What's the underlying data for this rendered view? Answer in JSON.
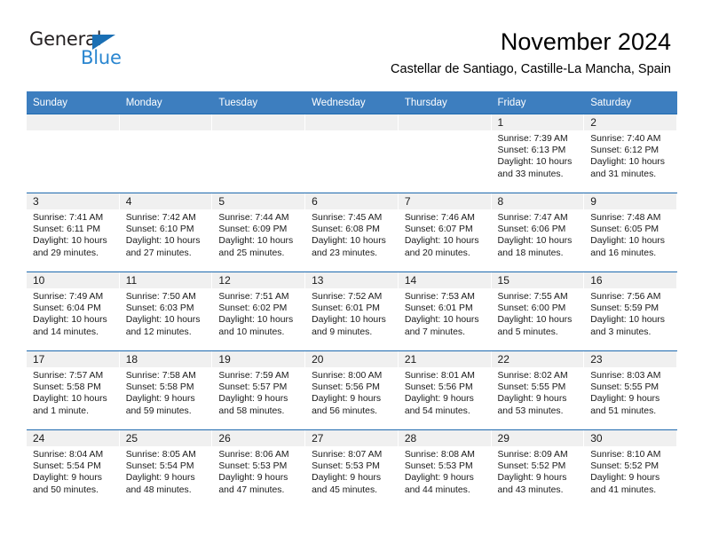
{
  "brand": {
    "name_part1": "General",
    "name_part2": "Blue",
    "accent_color": "#2a86d0",
    "triangle_color": "#1a6fb4"
  },
  "header": {
    "title": "November 2024",
    "subtitle": "Castellar de Santiago, Castille-La Mancha, Spain",
    "header_bg": "#3d7ebf",
    "header_text": "#ffffff",
    "row_rule_color": "#1f6aaf",
    "daynum_band_bg": "#f0f0f0"
  },
  "weekday_headers": [
    "Sunday",
    "Monday",
    "Tuesday",
    "Wednesday",
    "Thursday",
    "Friday",
    "Saturday"
  ],
  "labels": {
    "sunrise_prefix": "Sunrise:",
    "sunset_prefix": "Sunset:",
    "daylight_prefix": "Daylight:"
  },
  "weeks": [
    [
      {
        "day": "",
        "sunrise": "",
        "sunset": "",
        "daylight": "",
        "empty": true
      },
      {
        "day": "",
        "sunrise": "",
        "sunset": "",
        "daylight": "",
        "empty": true
      },
      {
        "day": "",
        "sunrise": "",
        "sunset": "",
        "daylight": "",
        "empty": true
      },
      {
        "day": "",
        "sunrise": "",
        "sunset": "",
        "daylight": "",
        "empty": true
      },
      {
        "day": "",
        "sunrise": "",
        "sunset": "",
        "daylight": "",
        "empty": true
      },
      {
        "day": "1",
        "sunrise": "Sunrise: 7:39 AM",
        "sunset": "Sunset: 6:13 PM",
        "daylight": "Daylight: 10 hours and 33 minutes.",
        "empty": false
      },
      {
        "day": "2",
        "sunrise": "Sunrise: 7:40 AM",
        "sunset": "Sunset: 6:12 PM",
        "daylight": "Daylight: 10 hours and 31 minutes.",
        "empty": false
      }
    ],
    [
      {
        "day": "3",
        "sunrise": "Sunrise: 7:41 AM",
        "sunset": "Sunset: 6:11 PM",
        "daylight": "Daylight: 10 hours and 29 minutes.",
        "empty": false
      },
      {
        "day": "4",
        "sunrise": "Sunrise: 7:42 AM",
        "sunset": "Sunset: 6:10 PM",
        "daylight": "Daylight: 10 hours and 27 minutes.",
        "empty": false
      },
      {
        "day": "5",
        "sunrise": "Sunrise: 7:44 AM",
        "sunset": "Sunset: 6:09 PM",
        "daylight": "Daylight: 10 hours and 25 minutes.",
        "empty": false
      },
      {
        "day": "6",
        "sunrise": "Sunrise: 7:45 AM",
        "sunset": "Sunset: 6:08 PM",
        "daylight": "Daylight: 10 hours and 23 minutes.",
        "empty": false
      },
      {
        "day": "7",
        "sunrise": "Sunrise: 7:46 AM",
        "sunset": "Sunset: 6:07 PM",
        "daylight": "Daylight: 10 hours and 20 minutes.",
        "empty": false
      },
      {
        "day": "8",
        "sunrise": "Sunrise: 7:47 AM",
        "sunset": "Sunset: 6:06 PM",
        "daylight": "Daylight: 10 hours and 18 minutes.",
        "empty": false
      },
      {
        "day": "9",
        "sunrise": "Sunrise: 7:48 AM",
        "sunset": "Sunset: 6:05 PM",
        "daylight": "Daylight: 10 hours and 16 minutes.",
        "empty": false
      }
    ],
    [
      {
        "day": "10",
        "sunrise": "Sunrise: 7:49 AM",
        "sunset": "Sunset: 6:04 PM",
        "daylight": "Daylight: 10 hours and 14 minutes.",
        "empty": false
      },
      {
        "day": "11",
        "sunrise": "Sunrise: 7:50 AM",
        "sunset": "Sunset: 6:03 PM",
        "daylight": "Daylight: 10 hours and 12 minutes.",
        "empty": false
      },
      {
        "day": "12",
        "sunrise": "Sunrise: 7:51 AM",
        "sunset": "Sunset: 6:02 PM",
        "daylight": "Daylight: 10 hours and 10 minutes.",
        "empty": false
      },
      {
        "day": "13",
        "sunrise": "Sunrise: 7:52 AM",
        "sunset": "Sunset: 6:01 PM",
        "daylight": "Daylight: 10 hours and 9 minutes.",
        "empty": false
      },
      {
        "day": "14",
        "sunrise": "Sunrise: 7:53 AM",
        "sunset": "Sunset: 6:01 PM",
        "daylight": "Daylight: 10 hours and 7 minutes.",
        "empty": false
      },
      {
        "day": "15",
        "sunrise": "Sunrise: 7:55 AM",
        "sunset": "Sunset: 6:00 PM",
        "daylight": "Daylight: 10 hours and 5 minutes.",
        "empty": false
      },
      {
        "day": "16",
        "sunrise": "Sunrise: 7:56 AM",
        "sunset": "Sunset: 5:59 PM",
        "daylight": "Daylight: 10 hours and 3 minutes.",
        "empty": false
      }
    ],
    [
      {
        "day": "17",
        "sunrise": "Sunrise: 7:57 AM",
        "sunset": "Sunset: 5:58 PM",
        "daylight": "Daylight: 10 hours and 1 minute.",
        "empty": false
      },
      {
        "day": "18",
        "sunrise": "Sunrise: 7:58 AM",
        "sunset": "Sunset: 5:58 PM",
        "daylight": "Daylight: 9 hours and 59 minutes.",
        "empty": false
      },
      {
        "day": "19",
        "sunrise": "Sunrise: 7:59 AM",
        "sunset": "Sunset: 5:57 PM",
        "daylight": "Daylight: 9 hours and 58 minutes.",
        "empty": false
      },
      {
        "day": "20",
        "sunrise": "Sunrise: 8:00 AM",
        "sunset": "Sunset: 5:56 PM",
        "daylight": "Daylight: 9 hours and 56 minutes.",
        "empty": false
      },
      {
        "day": "21",
        "sunrise": "Sunrise: 8:01 AM",
        "sunset": "Sunset: 5:56 PM",
        "daylight": "Daylight: 9 hours and 54 minutes.",
        "empty": false
      },
      {
        "day": "22",
        "sunrise": "Sunrise: 8:02 AM",
        "sunset": "Sunset: 5:55 PM",
        "daylight": "Daylight: 9 hours and 53 minutes.",
        "empty": false
      },
      {
        "day": "23",
        "sunrise": "Sunrise: 8:03 AM",
        "sunset": "Sunset: 5:55 PM",
        "daylight": "Daylight: 9 hours and 51 minutes.",
        "empty": false
      }
    ],
    [
      {
        "day": "24",
        "sunrise": "Sunrise: 8:04 AM",
        "sunset": "Sunset: 5:54 PM",
        "daylight": "Daylight: 9 hours and 50 minutes.",
        "empty": false
      },
      {
        "day": "25",
        "sunrise": "Sunrise: 8:05 AM",
        "sunset": "Sunset: 5:54 PM",
        "daylight": "Daylight: 9 hours and 48 minutes.",
        "empty": false
      },
      {
        "day": "26",
        "sunrise": "Sunrise: 8:06 AM",
        "sunset": "Sunset: 5:53 PM",
        "daylight": "Daylight: 9 hours and 47 minutes.",
        "empty": false
      },
      {
        "day": "27",
        "sunrise": "Sunrise: 8:07 AM",
        "sunset": "Sunset: 5:53 PM",
        "daylight": "Daylight: 9 hours and 45 minutes.",
        "empty": false
      },
      {
        "day": "28",
        "sunrise": "Sunrise: 8:08 AM",
        "sunset": "Sunset: 5:53 PM",
        "daylight": "Daylight: 9 hours and 44 minutes.",
        "empty": false
      },
      {
        "day": "29",
        "sunrise": "Sunrise: 8:09 AM",
        "sunset": "Sunset: 5:52 PM",
        "daylight": "Daylight: 9 hours and 43 minutes.",
        "empty": false
      },
      {
        "day": "30",
        "sunrise": "Sunrise: 8:10 AM",
        "sunset": "Sunset: 5:52 PM",
        "daylight": "Daylight: 9 hours and 41 minutes.",
        "empty": false
      }
    ]
  ]
}
